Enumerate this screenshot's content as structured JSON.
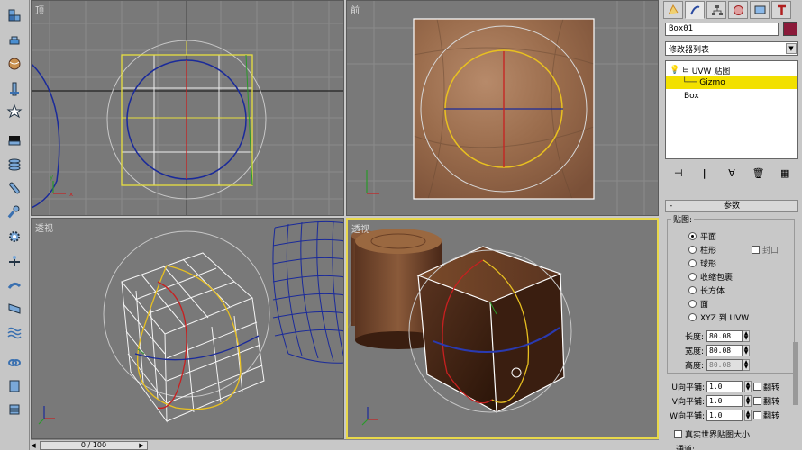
{
  "viewports": {
    "top": {
      "label": "顶"
    },
    "front": {
      "label": "前"
    },
    "persp_left": {
      "label": "透视"
    },
    "persp_right": {
      "label": "透视"
    }
  },
  "panel": {
    "object_name": "Box01",
    "object_color": "#8b1a3a",
    "modifier_list": "修改器列表",
    "stack": {
      "uvw_map": "UVW 贴图",
      "gizmo": "Gizmo",
      "box": "Box"
    },
    "rollout_title": "参数",
    "mapping_group": "贴图:",
    "mapping_options": [
      "平面",
      "柱形",
      "球形",
      "收缩包裹",
      "长方体",
      "面",
      "XYZ 到 UVW"
    ],
    "cap_label": "封口",
    "length_label": "长度:",
    "width_label": "宽度:",
    "height_label": "高度:",
    "length_value": "80.08",
    "width_value": "80.08",
    "height_value": "80.08",
    "u_tile_label": "U向平铺:",
    "v_tile_label": "V向平铺:",
    "w_tile_label": "W向平铺:",
    "u_tile": "1.0",
    "v_tile": "1.0",
    "w_tile": "1.0",
    "flip_label": "翻转",
    "real_world_label": "真实世界贴图大小",
    "channel_label": "通道:"
  },
  "timeline": {
    "frame": "0 / 100"
  }
}
